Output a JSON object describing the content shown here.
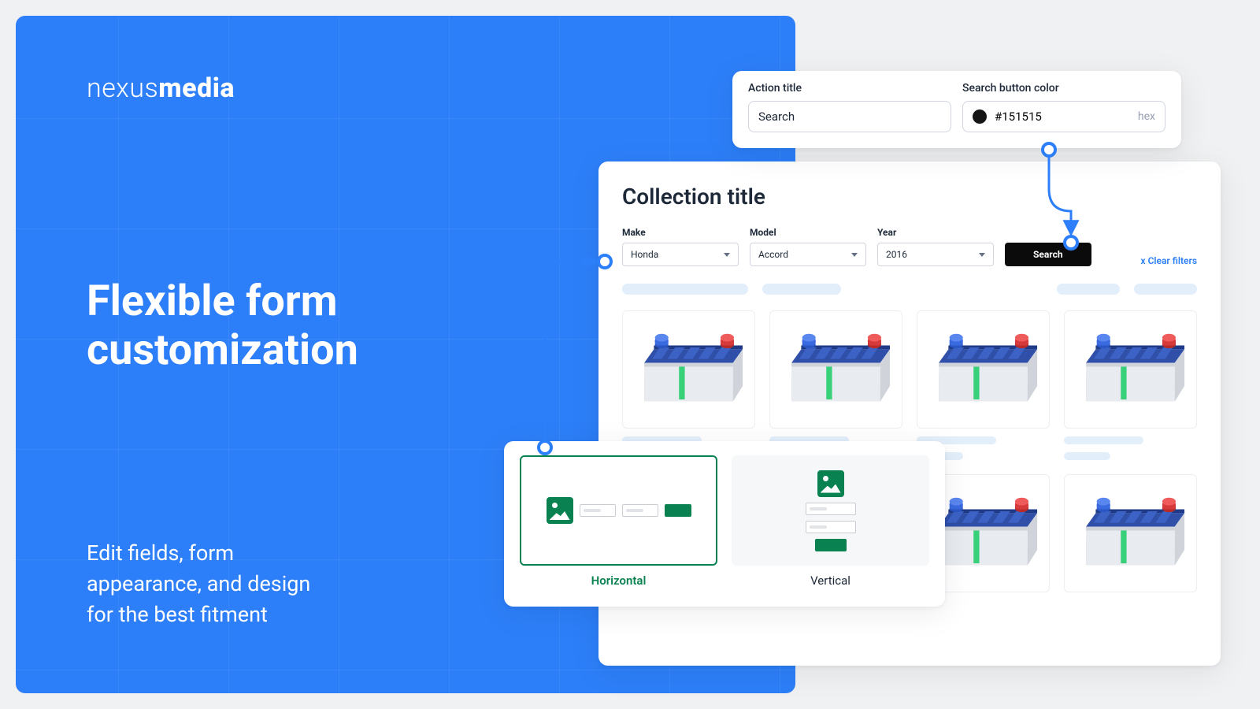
{
  "brand": {
    "part1": "nexus",
    "part2": "media"
  },
  "hero": {
    "headline_l1": "Flexible form",
    "headline_l2": "customization",
    "sub_l1": "Edit fields, form",
    "sub_l2": "appearance, and design",
    "sub_l3": "for the best fitment"
  },
  "config": {
    "action_title_label": "Action title",
    "action_title_value": "Search",
    "color_label": "Search button color",
    "color_value": "#151515",
    "color_format": "hex"
  },
  "preview": {
    "title": "Collection title",
    "filters": {
      "make": {
        "label": "Make",
        "value": "Honda"
      },
      "model": {
        "label": "Model",
        "value": "Accord"
      },
      "year": {
        "label": "Year",
        "value": "2016"
      }
    },
    "search_label": "Search",
    "clear_label": "x Clear filters"
  },
  "layout": {
    "horizontal": "Horizontal",
    "vertical": "Vertical"
  }
}
